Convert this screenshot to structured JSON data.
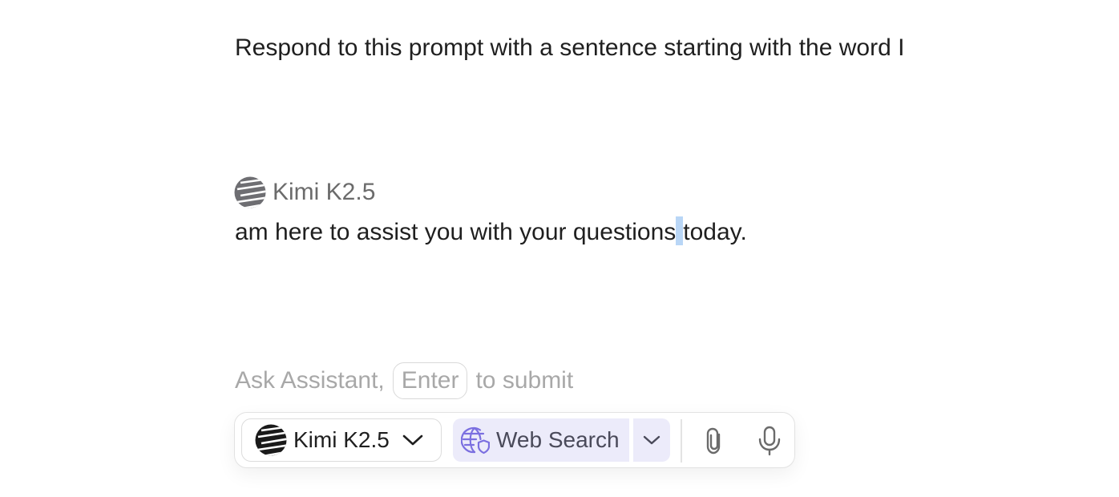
{
  "conversation": {
    "user_message": "Respond to this prompt with a sentence starting with the word I",
    "assistant": {
      "model_name": "Kimi K2.5",
      "message_before_selection": "am here to assist you with your questions",
      "message_after_selection": "today."
    }
  },
  "composer": {
    "hint_prefix": "Ask Assistant,",
    "hint_key": "Enter",
    "hint_suffix": "to submit"
  },
  "toolbar": {
    "model_selector_label": "Kimi K2.5",
    "web_search_label": "Web Search",
    "accent_color": "#ecebfa",
    "web_search_icon_color": "#7b6fe0"
  },
  "icons": {
    "model_logo": "kimi-logo-icon",
    "model_chevron": "chevron-down-icon",
    "web_search": "globe-shield-icon",
    "web_search_chevron": "chevron-down-icon",
    "attach": "paperclip-icon",
    "mic": "microphone-icon"
  }
}
